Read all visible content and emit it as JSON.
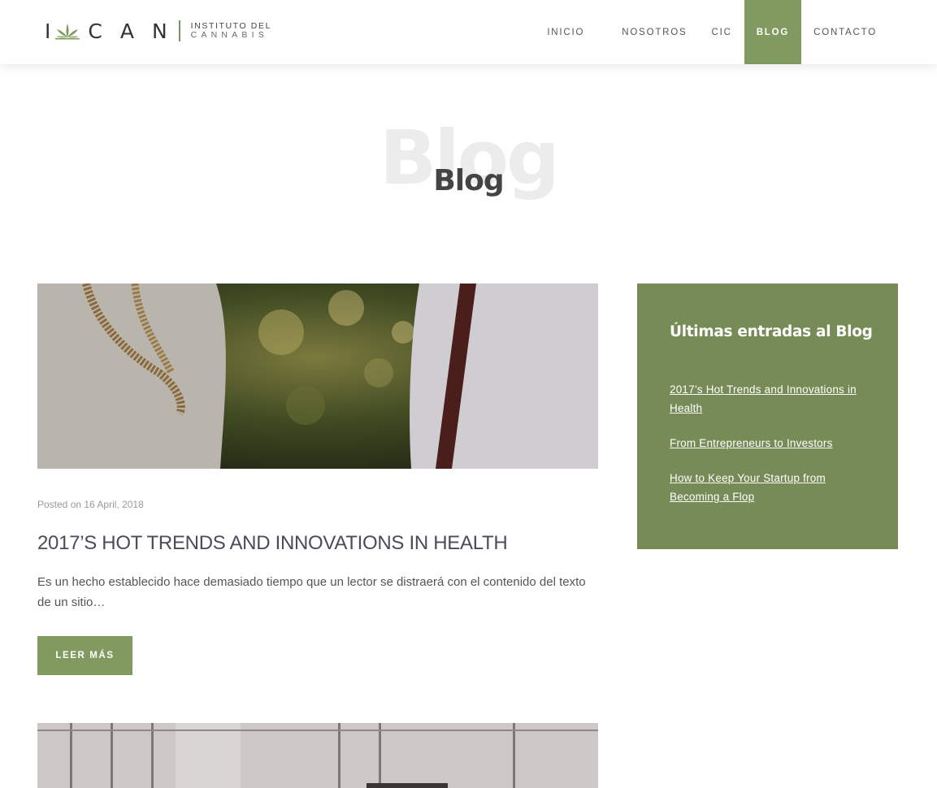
{
  "brand": {
    "logo_i": "I",
    "logo_c": "C",
    "logo_a": "A",
    "logo_n": "N",
    "subtitle_line1": "INSTITUTO DEL",
    "subtitle_line2": "CANNABIS",
    "logo_icon": "cannabis-leaf-icon",
    "accent_color": "#819a5f"
  },
  "nav": {
    "items": [
      {
        "label": "INICIO",
        "active": false
      },
      {
        "label": "NOSOTROS",
        "active": false
      },
      {
        "label": "CIC",
        "active": false
      },
      {
        "label": "BLOG",
        "active": true
      },
      {
        "label": "CONTACTO",
        "active": false
      }
    ]
  },
  "hero": {
    "background_text": "Blog",
    "title": "Blog"
  },
  "post": {
    "meta": "Posted on 16 April, 2018",
    "title": "2017’S HOT TRENDS AND INNOVATIONS IN HEALTH",
    "excerpt": "Es un hecho establecido hace demasiado tiempo que un lector se distraerá con el contenido del texto de un sitio…",
    "read_more": "LEER MÁS"
  },
  "sidebar": {
    "title": "Últimas entradas al Blog",
    "links": [
      "2017’s Hot Trends and Innovations in Health",
      "From Entrepreneurs to Investors",
      "How to Keep Your Startup from Becoming a Flop"
    ],
    "background_color": "#768b56"
  }
}
